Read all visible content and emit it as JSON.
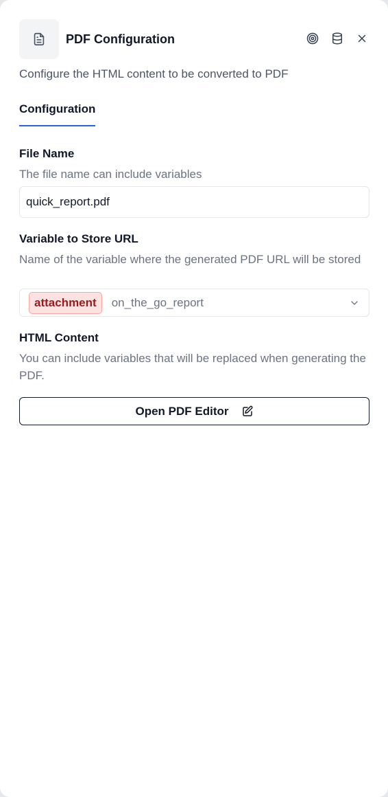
{
  "header": {
    "title": "PDF Configuration",
    "description": "Configure the HTML content to be converted to PDF",
    "icons": [
      "file-text-icon",
      "target-icon",
      "database-icon",
      "close-icon"
    ]
  },
  "tabs": [
    {
      "label": "Configuration",
      "active": true
    }
  ],
  "file_name": {
    "label": "File Name",
    "help": "The file name can include variables",
    "value": "quick_report.pdf"
  },
  "store_url": {
    "label": "Variable to Store URL",
    "help": "Name of the variable where the generated PDF URL will be stored",
    "badge": "attachment",
    "value": "on_the_go_report"
  },
  "html_content": {
    "label": "HTML Content",
    "help": "You can include variables that will be replaced when generating the PDF.",
    "button_label": "Open PDF Editor"
  },
  "colors": {
    "accent": "#2563eb",
    "badge_bg": "#fee2e2",
    "badge_text": "#991b1b"
  }
}
